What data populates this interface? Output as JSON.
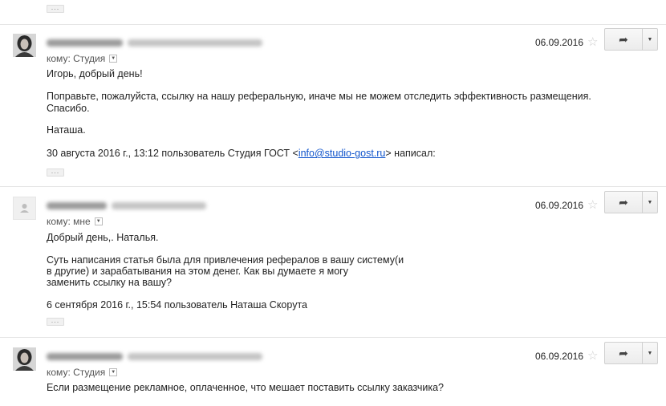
{
  "messages": [
    {
      "recipient": "кому: Студия",
      "date": "06.09.2016",
      "lines": [
        "Игорь, добрый день!",
        "Поправьте, пожалуйста, ссылку на нашу реферальную, иначе мы не можем отследить эффективность размещения.",
        "Спасибо.",
        "Наташа."
      ],
      "quote_prefix": "30 августа 2016 г., 13:12 пользователь Студия ГОСТ <",
      "quote_email": "info@studio-gost.ru",
      "quote_suffix": "> написал:"
    },
    {
      "recipient": "кому: мне",
      "date": "06.09.2016",
      "lines": [
        "Добрый день,. Наталья.",
        "Суть написания статья была для привлечения рефералов в вашу систему(и",
        "в другие) и зарабатывания на этом денег. Как вы думаете я могу",
        "заменить ссылку на вашу?",
        "6 сентября 2016 г., 15:54 пользователь Наташа Скорута"
      ]
    },
    {
      "recipient": "кому: Студия",
      "date": "06.09.2016",
      "lines": [
        "Если размещение рекламное, оплаченное, что мешает поставить ссылку заказчика?"
      ]
    }
  ],
  "ellipsis": "...",
  "icons": {
    "star": "star-icon",
    "reply": "reply-icon",
    "more": "dropdown-arrow-icon"
  }
}
